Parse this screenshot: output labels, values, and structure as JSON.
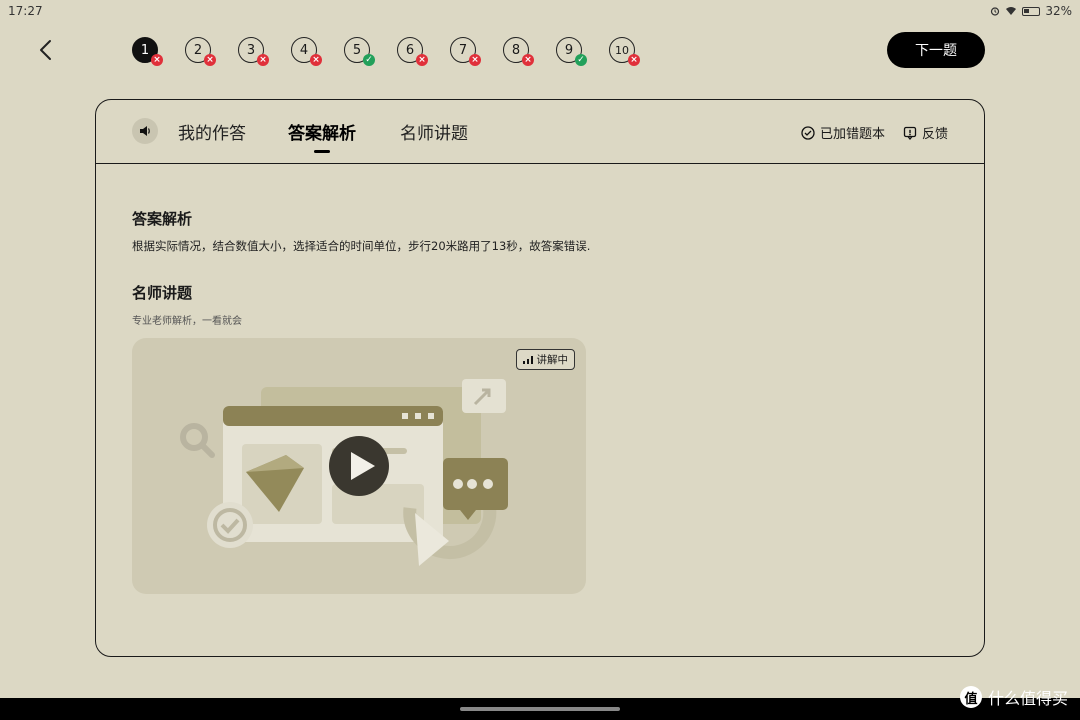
{
  "status": {
    "time": "17:27",
    "battery": "32%"
  },
  "questions": [
    {
      "num": "1",
      "result": "wrong",
      "current": true
    },
    {
      "num": "2",
      "result": "wrong"
    },
    {
      "num": "3",
      "result": "wrong"
    },
    {
      "num": "4",
      "result": "wrong"
    },
    {
      "num": "5",
      "result": "right"
    },
    {
      "num": "6",
      "result": "wrong"
    },
    {
      "num": "7",
      "result": "wrong"
    },
    {
      "num": "8",
      "result": "wrong"
    },
    {
      "num": "9",
      "result": "right"
    },
    {
      "num": "10",
      "result": "wrong"
    }
  ],
  "next_label": "下一题",
  "tabs": {
    "my_answer": "我的作答",
    "analysis": "答案解析",
    "teacher": "名师讲题"
  },
  "actions": {
    "added_wrongbook": "已加错题本",
    "feedback": "反馈"
  },
  "analysis": {
    "title": "答案解析",
    "text": "根据实际情况，结合数值大小，选择适合的时间单位，步行20米路用了13秒，故答案错误."
  },
  "teacher": {
    "title": "名师讲题",
    "subtitle": "专业老师解析，一看就会",
    "badge": "讲解中"
  },
  "watermark": {
    "logo": "值",
    "text": "什么值得买"
  },
  "colors": {
    "wrong": "#e0303a",
    "right": "#22a05a",
    "background": "#dcd8c4"
  }
}
